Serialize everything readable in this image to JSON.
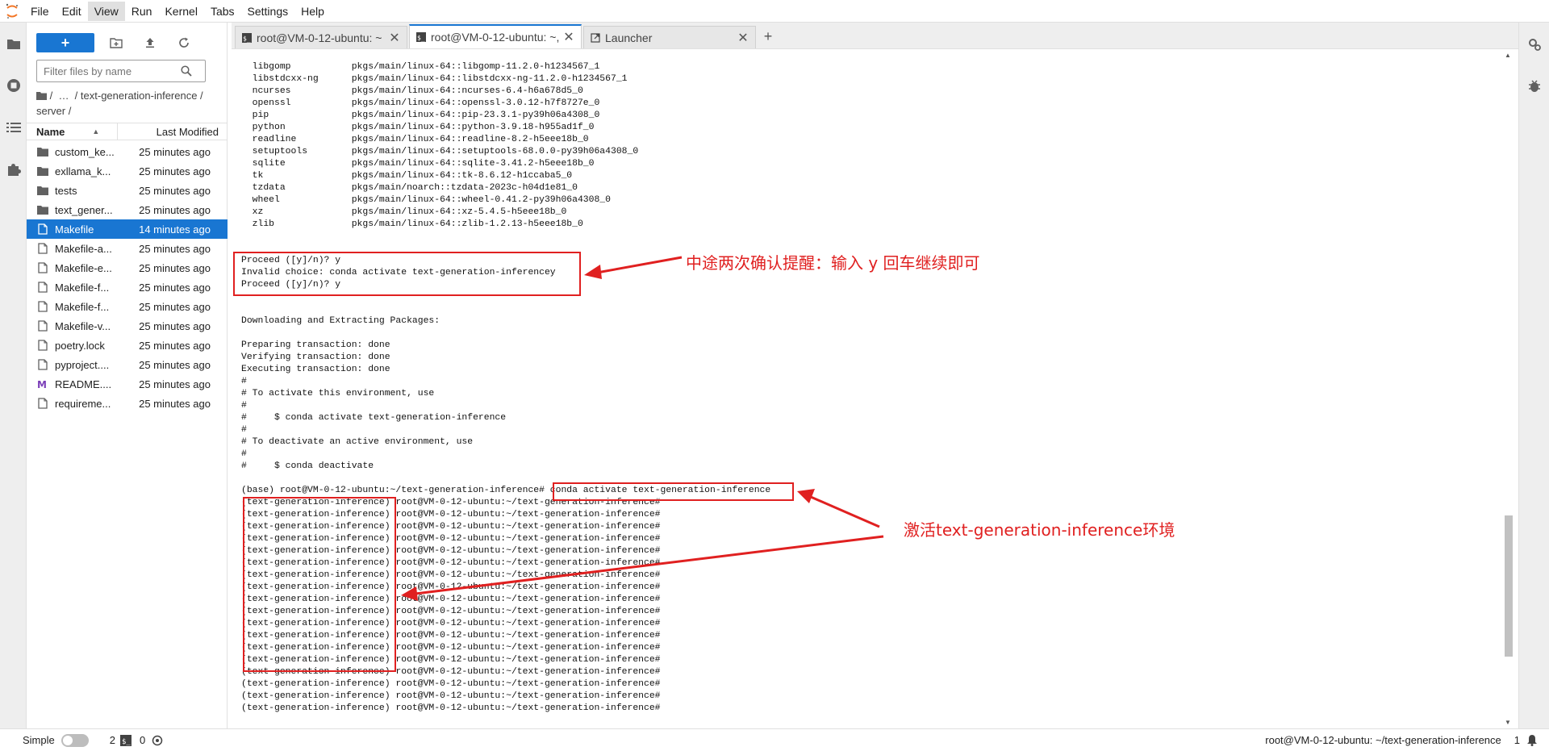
{
  "menu": [
    "File",
    "Edit",
    "View",
    "Run",
    "Kernel",
    "Tabs",
    "Settings",
    "Help"
  ],
  "menu_active": "View",
  "file_browser": {
    "new_label": "+",
    "search_placeholder": "Filter files by name",
    "breadcrumb": "/  …  / text-generation-inference / server /",
    "col_name": "Name",
    "col_modified": "Last Modified",
    "files": [
      {
        "name": "custom_ke...",
        "modified": "25 minutes ago",
        "type": "folder"
      },
      {
        "name": "exllama_k...",
        "modified": "25 minutes ago",
        "type": "folder"
      },
      {
        "name": "tests",
        "modified": "25 minutes ago",
        "type": "folder"
      },
      {
        "name": "text_gener...",
        "modified": "25 minutes ago",
        "type": "folder"
      },
      {
        "name": "Makefile",
        "modified": "14 minutes ago",
        "type": "file"
      },
      {
        "name": "Makefile-a...",
        "modified": "25 minutes ago",
        "type": "file"
      },
      {
        "name": "Makefile-e...",
        "modified": "25 minutes ago",
        "type": "file"
      },
      {
        "name": "Makefile-f...",
        "modified": "25 minutes ago",
        "type": "file"
      },
      {
        "name": "Makefile-f...",
        "modified": "25 minutes ago",
        "type": "file"
      },
      {
        "name": "Makefile-v...",
        "modified": "25 minutes ago",
        "type": "file"
      },
      {
        "name": "poetry.lock",
        "modified": "25 minutes ago",
        "type": "file"
      },
      {
        "name": "pyproject....",
        "modified": "25 minutes ago",
        "type": "file"
      },
      {
        "name": "README....",
        "modified": "25 minutes ago",
        "type": "markdown"
      },
      {
        "name": "requireme...",
        "modified": "25 minutes ago",
        "type": "file"
      }
    ]
  },
  "tabs": [
    {
      "label": "root@VM-0-12-ubuntu: ~",
      "icon": "terminal-icon"
    },
    {
      "label": "root@VM-0-12-ubuntu: ~,",
      "icon": "terminal-icon"
    },
    {
      "label": "Launcher",
      "icon": "launcher-icon"
    }
  ],
  "terminal_lines": [
    "  libgomp           pkgs/main/linux-64::libgomp-11.2.0-h1234567_1",
    "  libstdcxx-ng      pkgs/main/linux-64::libstdcxx-ng-11.2.0-h1234567_1",
    "  ncurses           pkgs/main/linux-64::ncurses-6.4-h6a678d5_0",
    "  openssl           pkgs/main/linux-64::openssl-3.0.12-h7f8727e_0",
    "  pip               pkgs/main/linux-64::pip-23.3.1-py39h06a4308_0",
    "  python            pkgs/main/linux-64::python-3.9.18-h955ad1f_0",
    "  readline          pkgs/main/linux-64::readline-8.2-h5eee18b_0",
    "  setuptools        pkgs/main/linux-64::setuptools-68.0.0-py39h06a4308_0",
    "  sqlite            pkgs/main/linux-64::sqlite-3.41.2-h5eee18b_0",
    "  tk                pkgs/main/linux-64::tk-8.6.12-h1ccaba5_0",
    "  tzdata            pkgs/main/noarch::tzdata-2023c-h04d1e81_0",
    "  wheel             pkgs/main/linux-64::wheel-0.41.2-py39h06a4308_0",
    "  xz                pkgs/main/linux-64::xz-5.4.5-h5eee18b_0",
    "  zlib              pkgs/main/linux-64::zlib-1.2.13-h5eee18b_0",
    "",
    "",
    "Proceed ([y]/n)? y",
    "Invalid choice: conda activate text-generation-inferencey",
    "Proceed ([y]/n)? y",
    "",
    "",
    "Downloading and Extracting Packages:",
    "",
    "Preparing transaction: done",
    "Verifying transaction: done",
    "Executing transaction: done",
    "#",
    "# To activate this environment, use",
    "#",
    "#     $ conda activate text-generation-inference",
    "#",
    "# To deactivate an active environment, use",
    "#",
    "#     $ conda deactivate",
    "",
    "(base) root@VM-0-12-ubuntu:~/text-generation-inference# conda activate text-generation-inference",
    "(text-generation-inference) root@VM-0-12-ubuntu:~/text-generation-inference#",
    "(text-generation-inference) root@VM-0-12-ubuntu:~/text-generation-inference#",
    "(text-generation-inference) root@VM-0-12-ubuntu:~/text-generation-inference#",
    "(text-generation-inference) root@VM-0-12-ubuntu:~/text-generation-inference#",
    "(text-generation-inference) root@VM-0-12-ubuntu:~/text-generation-inference#",
    "(text-generation-inference) root@VM-0-12-ubuntu:~/text-generation-inference#",
    "(text-generation-inference) root@VM-0-12-ubuntu:~/text-generation-inference#",
    "(text-generation-inference) root@VM-0-12-ubuntu:~/text-generation-inference#",
    "(text-generation-inference) root@VM-0-12-ubuntu:~/text-generation-inference#",
    "(text-generation-inference) root@VM-0-12-ubuntu:~/text-generation-inference#",
    "(text-generation-inference) root@VM-0-12-ubuntu:~/text-generation-inference#",
    "(text-generation-inference) root@VM-0-12-ubuntu:~/text-generation-inference#",
    "(text-generation-inference) root@VM-0-12-ubuntu:~/text-generation-inference#",
    "(text-generation-inference) root@VM-0-12-ubuntu:~/text-generation-inference#",
    "(text-generation-inference) root@VM-0-12-ubuntu:~/text-generation-inference#",
    "(text-generation-inference) root@VM-0-12-ubuntu:~/text-generation-inference#",
    "(text-generation-inference) root@VM-0-12-ubuntu:~/text-generation-inference#",
    "(text-generation-inference) root@VM-0-12-ubuntu:~/text-generation-inference#"
  ],
  "annotations": {
    "confirm_note": "中途两次确认提醒：输入 y 回车继续即可",
    "activate_note": "激活text-generation-inference环境",
    "accent_color": "#e02020"
  },
  "status": {
    "mode_label": "Simple",
    "count_a": "2",
    "count_b": "0",
    "right_text": "root@VM-0-12-ubuntu: ~/text-generation-inference",
    "right_num": "1"
  }
}
